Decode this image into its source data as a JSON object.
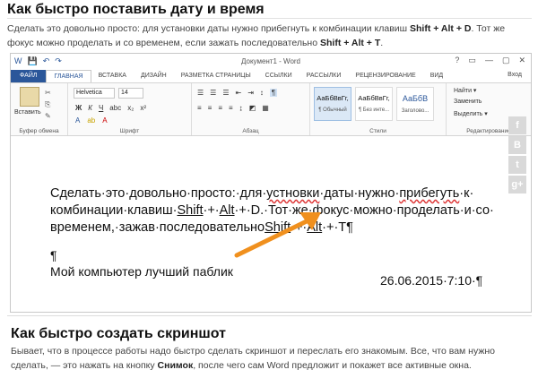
{
  "heading1": "Как быстро поставить дату и время",
  "para1": {
    "text1": "Сделать это довольно просто: для установки даты нужно прибегнуть к комбинации клавиш ",
    "keys1": "Shift + Alt + D",
    "text2": ". Тот же фокус можно проделать и со временем, если зажать последовательно ",
    "keys2": "Shift + Alt + T",
    "text3": "."
  },
  "word": {
    "title": "Документ1 - Word",
    "window_buttons": [
      "?",
      "▭",
      "—",
      "▢",
      "✕"
    ],
    "tabs": [
      "ФАЙЛ",
      "ГЛАВНАЯ",
      "ВСТАВКА",
      "ДИЗАЙН",
      "РАЗМЕТКА СТРАНИЦЫ",
      "ССЫЛКИ",
      "РАССЫЛКИ",
      "РЕЦЕНЗИРОВАНИЕ",
      "ВИД"
    ],
    "signin": "Вход",
    "paste_label": "Вставить",
    "groups": [
      "Буфер обмена",
      "Шрифт",
      "Абзац",
      "Стили",
      "Редактирование"
    ],
    "font_name": "Helvetica",
    "font_size": "14",
    "styles": [
      {
        "preview": "АаБбВвГг,",
        "name": "¶ Обычный"
      },
      {
        "preview": "АаБбВвГг,",
        "name": "¶ Без инте..."
      },
      {
        "preview": "АаБбВ",
        "name": "Заголово..."
      }
    ],
    "edit_items": [
      "Найти ▾",
      "Заменить",
      "Выделить ▾"
    ],
    "doc_line1a": "Сделать·это·довольно·просто:·для·",
    "doc_line1b": "устновки",
    "doc_line1c": "·даты·нужно·",
    "doc_line1d": "прибегуть",
    "doc_line1e": "·к·",
    "doc_line2a": "комбинации·клавиш·",
    "doc_line2b": "Shift",
    "doc_line2c": "·+·",
    "doc_line2d": "Alt",
    "doc_line2e": "·+·D.·Тот·же·фокус·можно·проделать·и·со·",
    "doc_line3a": "временем,·зажав·последовательно",
    "doc_line3b": "Shift",
    "doc_line3c": "·+·",
    "doc_line3d": "Alt",
    "doc_line3e": "·+·T¶",
    "pilcrow": "¶",
    "mypc": "Мой компьютер лучший паблик",
    "date": "26.06.2015·7:10·¶",
    "social": [
      "f",
      "B",
      "t",
      "g+"
    ]
  },
  "heading2": "Как быстро создать скриншот",
  "para2": {
    "text1": "Бывает, что в процессе работы надо быстро сделать скриншот и переслать его знакомым. Все, что вам нужно сделать, — это нажать на кнопку ",
    "keys1": "Снимок",
    "text2": ", после чего сам Word предложит и покажет все активные окна."
  },
  "colors": {
    "word_blue": "#2b579a",
    "arrow": "#f0901e",
    "spell_error": "#d33"
  }
}
